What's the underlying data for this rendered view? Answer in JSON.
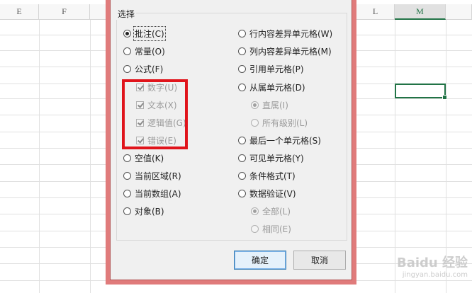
{
  "sheet": {
    "columns": [
      "E",
      "F",
      "L",
      "M"
    ]
  },
  "dialog": {
    "group_title": "选择",
    "left_options": [
      {
        "label": "批注(C)",
        "checked": true
      },
      {
        "label": "常量(O)",
        "checked": false
      },
      {
        "label": "公式(F)",
        "checked": false
      }
    ],
    "formula_subs": [
      {
        "label": "数字(U)",
        "checked": true
      },
      {
        "label": "文本(X)",
        "checked": true
      },
      {
        "label": "逻辑值(G)",
        "checked": true
      },
      {
        "label": "错误(E)",
        "checked": true
      }
    ],
    "left_options_2": [
      {
        "label": "空值(K)",
        "checked": false
      },
      {
        "label": "当前区域(R)",
        "checked": false
      },
      {
        "label": "当前数组(A)",
        "checked": false
      },
      {
        "label": "对象(B)",
        "checked": false
      }
    ],
    "right_options": [
      {
        "label": "行内容差异单元格(W)",
        "checked": false
      },
      {
        "label": "列内容差异单元格(M)",
        "checked": false
      },
      {
        "label": "引用单元格(P)",
        "checked": false
      },
      {
        "label": "从属单元格(D)",
        "checked": false
      }
    ],
    "dependents_subs": [
      {
        "label": "直属(I)",
        "checked": true
      },
      {
        "label": "所有级别(L)",
        "checked": false
      }
    ],
    "right_options_2": [
      {
        "label": "最后一个单元格(S)",
        "checked": false
      },
      {
        "label": "可见单元格(Y)",
        "checked": false
      },
      {
        "label": "条件格式(T)",
        "checked": false
      },
      {
        "label": "数据验证(V)",
        "checked": false
      }
    ],
    "validation_subs": [
      {
        "label": "全部(L)",
        "checked": true
      },
      {
        "label": "相同(E)",
        "checked": false
      }
    ],
    "ok_label": "确定",
    "cancel_label": "取消"
  },
  "watermark": {
    "text": "Baidu 经验",
    "url": "jingyan.baidu.com"
  }
}
